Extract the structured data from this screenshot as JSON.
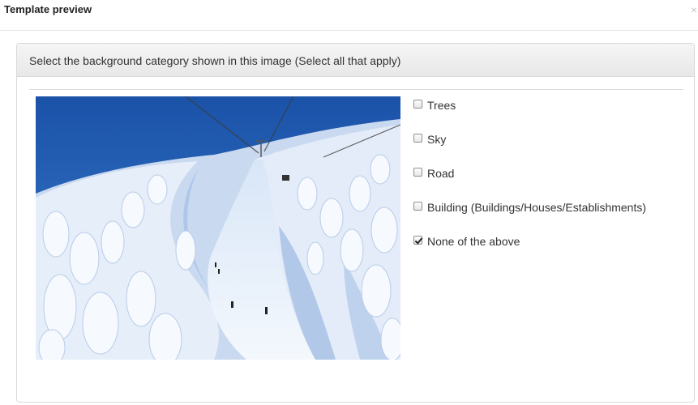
{
  "window": {
    "title": "Template preview",
    "close_glyph": "×"
  },
  "panel": {
    "question": "Select the background category shown in this image (Select all that apply)"
  },
  "image": {
    "icon": "photo-snowy-ski-slope-with-snow-monsters"
  },
  "options": [
    {
      "label": "Trees",
      "checked": false
    },
    {
      "label": "Sky",
      "checked": false
    },
    {
      "label": "Road",
      "checked": false
    },
    {
      "label": "Building (Buildings/Houses/Establishments)",
      "checked": false
    },
    {
      "label": "None of the above",
      "checked": true
    }
  ],
  "colors": {
    "sky": "#1f5cb0",
    "snow": "#eef4fb",
    "shadow": "#8fb1e0"
  }
}
